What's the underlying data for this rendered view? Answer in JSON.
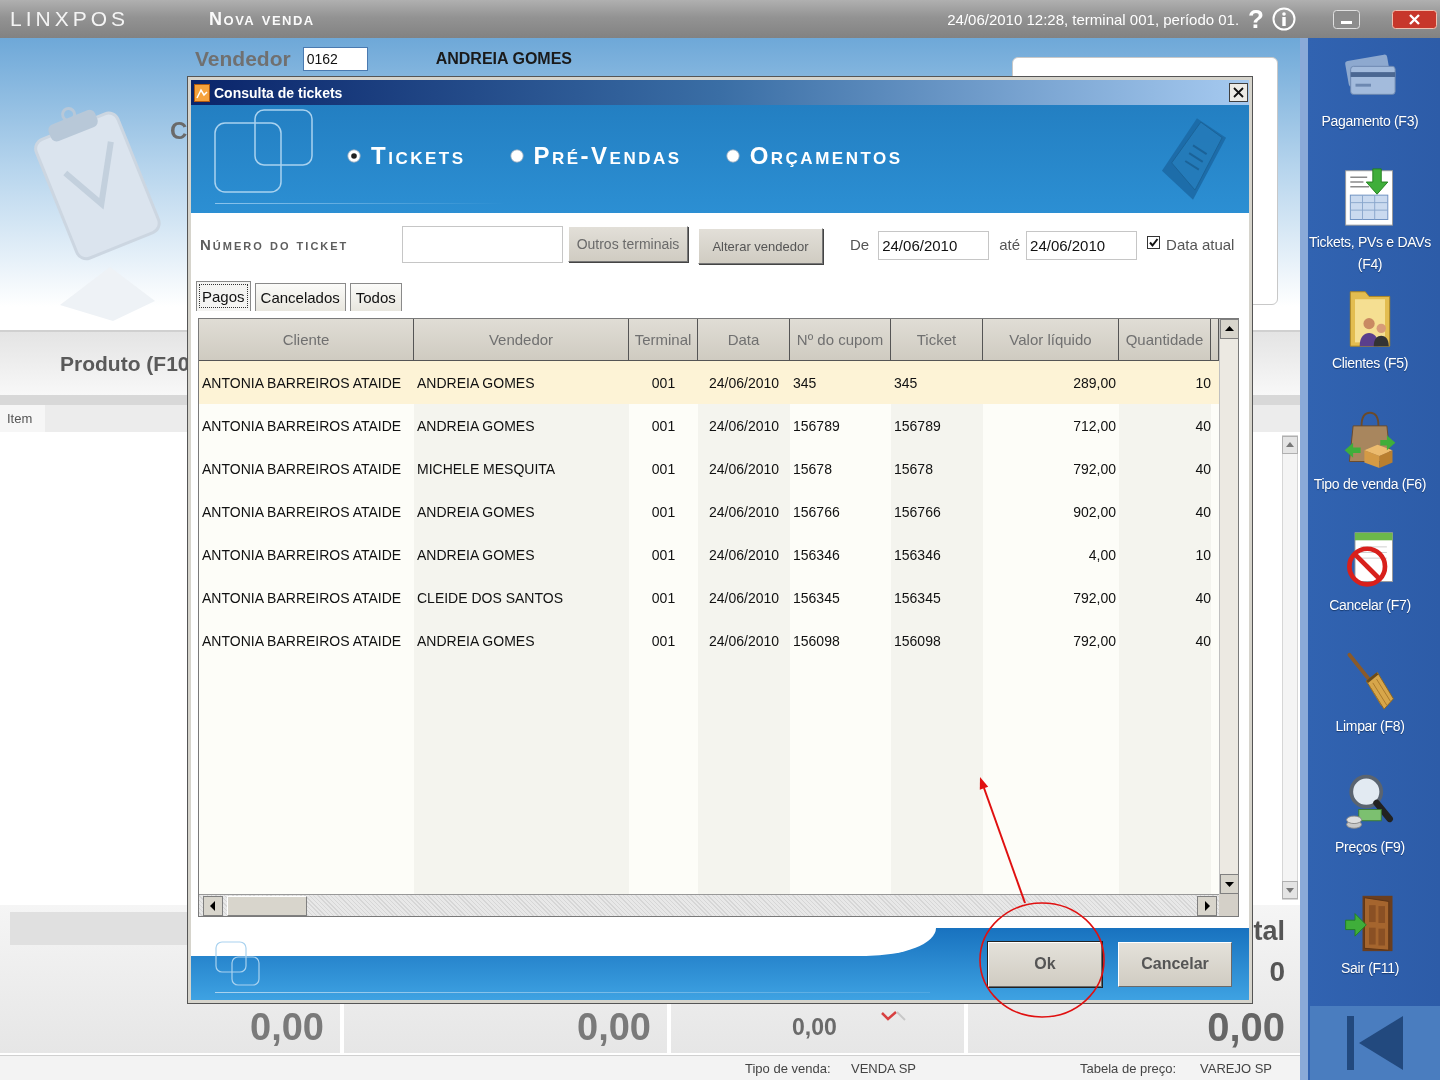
{
  "top_bar": {
    "logo": "LINXPOS",
    "title": "Nova venda",
    "session_info": "24/06/2010 12:28, terminal 001, período 01.",
    "help": "?"
  },
  "sale": {
    "seller_label": "Vendedor",
    "seller_code": "0162",
    "seller_name": "ANDREIA GOMES",
    "label_2": "C"
  },
  "product_bar": {
    "label": "Produto (F10"
  },
  "items_table": {
    "columns": [
      "Item"
    ]
  },
  "totals": {
    "values": [
      "0,00",
      "0,00",
      "0,00"
    ],
    "total_label": "tal",
    "total_count": "0",
    "total_value": "0,00"
  },
  "status_bar": [
    {
      "label": "Tipo de venda:",
      "value": "VENDA SP"
    },
    {
      "label": "Tabela de preço:",
      "value": "VAREJO SP"
    }
  ],
  "sidebar": {
    "items": [
      {
        "label": "Pagamento (F3)",
        "kind": "payment"
      },
      {
        "label": "Tickets, PVs e DAVs (F4)",
        "kind": "tickets"
      },
      {
        "label": "Clientes (F5)",
        "kind": "clients"
      },
      {
        "label": "Tipo de venda (F6)",
        "kind": "sale_type"
      },
      {
        "label": "Cancelar (F7)",
        "kind": "cancel"
      },
      {
        "label": "Limpar (F8)",
        "kind": "clear"
      },
      {
        "label": "Preços (F9)",
        "kind": "prices"
      },
      {
        "label": "Sair (F11)",
        "kind": "exit"
      }
    ]
  },
  "dialog": {
    "title": "Consulta de tickets",
    "modes": [
      {
        "label": "Tickets",
        "selected": true
      },
      {
        "label": "Pré-Vendas",
        "selected": false
      },
      {
        "label": "Orçamentos",
        "selected": false
      }
    ],
    "filter": {
      "ticket_label": "Número do ticket",
      "buttons": [
        "Outros terminais",
        "Alterar vendedor"
      ],
      "from_label": "De",
      "from_value": "24/06/2010",
      "to_label": "até",
      "to_value": "24/06/2010",
      "current_date": {
        "label": "Data atual",
        "checked": true
      }
    },
    "tabs": [
      {
        "label": "Pagos",
        "selected": true
      },
      {
        "label": "Cancelados",
        "selected": false
      },
      {
        "label": "Todos",
        "selected": false
      }
    ],
    "table": {
      "columns": [
        "Cliente",
        "Vendedor",
        "Terminal",
        "Data",
        "Nº do cupom",
        "Ticket",
        "Valor líquido",
        "Quantidade"
      ],
      "rows": [
        {
          "selected": true,
          "cells": [
            "ANTONIA BARREIROS ATAIDE",
            "ANDREIA GOMES",
            "001",
            "24/06/2010",
            "345",
            "345",
            "289,00",
            "10"
          ]
        },
        {
          "selected": false,
          "cells": [
            "ANTONIA BARREIROS ATAIDE",
            "ANDREIA GOMES",
            "001",
            "24/06/2010",
            "156789",
            "156789",
            "712,00",
            "40"
          ]
        },
        {
          "selected": false,
          "cells": [
            "ANTONIA BARREIROS ATAIDE",
            "MICHELE MESQUITA",
            "001",
            "24/06/2010",
            "15678",
            "15678",
            "792,00",
            "40"
          ]
        },
        {
          "selected": false,
          "cells": [
            "ANTONIA BARREIROS ATAIDE",
            "ANDREIA GOMES",
            "001",
            "24/06/2010",
            "156766",
            "156766",
            "902,00",
            "40"
          ]
        },
        {
          "selected": false,
          "cells": [
            "ANTONIA BARREIROS ATAIDE",
            "ANDREIA GOMES",
            "001",
            "24/06/2010",
            "156346",
            "156346",
            "4,00",
            "10"
          ]
        },
        {
          "selected": false,
          "cells": [
            "ANTONIA BARREIROS ATAIDE",
            "CLEIDE DOS SANTOS",
            "001",
            "24/06/2010",
            "156345",
            "156345",
            "792,00",
            "40"
          ]
        },
        {
          "selected": false,
          "cells": [
            "ANTONIA BARREIROS ATAIDE",
            "ANDREIA GOMES",
            "001",
            "24/06/2010",
            "156098",
            "156098",
            "792,00",
            "40"
          ]
        }
      ]
    },
    "buttons": [
      "Ok",
      "Cancelar"
    ]
  }
}
